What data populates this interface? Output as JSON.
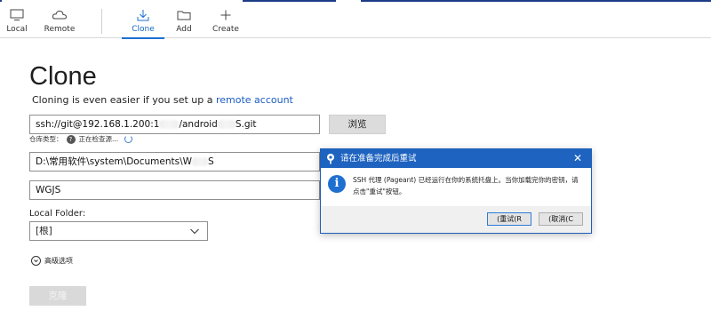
{
  "toolbar": {
    "local": "Local",
    "remote": "Remote",
    "clone": "Clone",
    "add": "Add",
    "create": "Create"
  },
  "main": {
    "title": "Clone",
    "subtitle_text": "Cloning is even easier if you set up a ",
    "subtitle_link": "remote account",
    "url_part1": "ssh://git@192.168.1.200:1",
    "url_part2": "/android",
    "url_part3": "S.git",
    "browse": "浏览",
    "repo_type_label": "仓库类型：",
    "repo_type_status": "正在检查源...",
    "path_value_prefix": "D:\\常用软件\\system\\Documents\\W",
    "path_value_suffix": "S",
    "name_value": "WGJS",
    "local_folder_label": "Local Folder:",
    "local_folder_value": "[根]",
    "advanced": "高级选项",
    "clone_button": "克隆"
  },
  "dialog": {
    "title": "请在准备完成后重试",
    "message": "SSH 代理 (Pageant) 已经运行在你的系统托盘上。当你加载完你的密钥，请点击\"重试\"按钮。",
    "retry": "(重试(R",
    "cancel": "(取消(C",
    "close": "✕"
  },
  "colors": {
    "accent": "#1b6fd0",
    "dialog_title_bg": "#1e63c0",
    "link": "#1a5cc4"
  }
}
